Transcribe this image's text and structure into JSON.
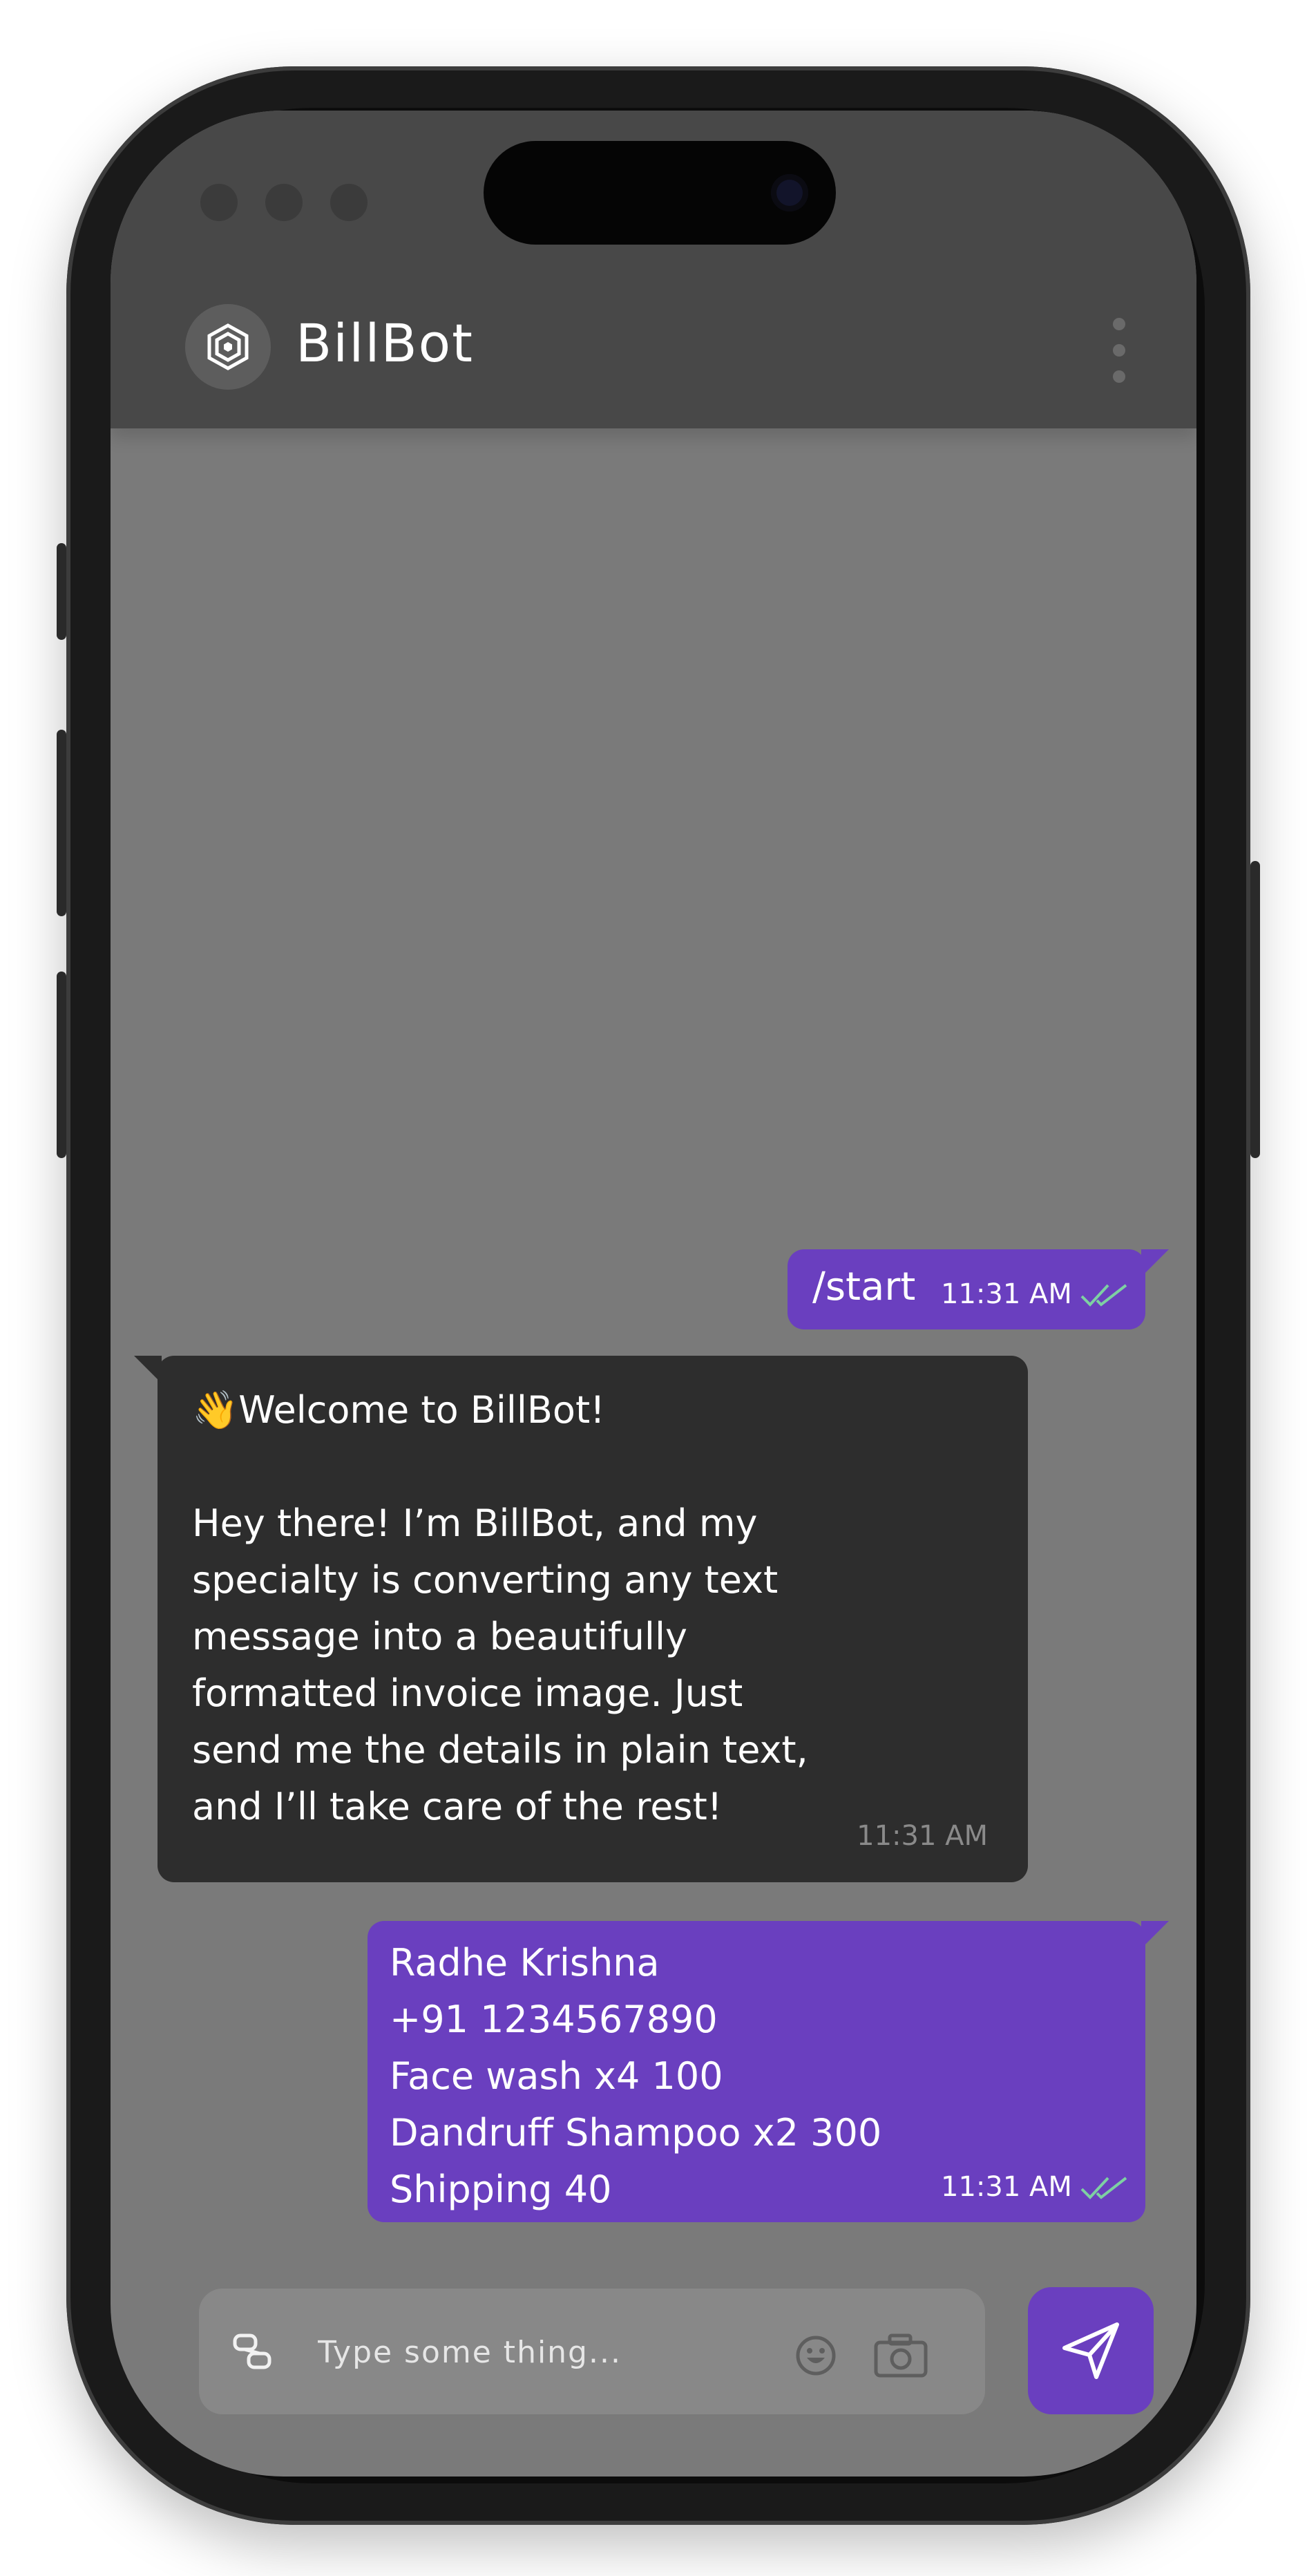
{
  "header": {
    "app_title": "BillBot",
    "logo_icon": "hexagon-logo-icon",
    "menu_icon": "kebab-menu-icon"
  },
  "messages": [
    {
      "sender": "user",
      "text": "/start",
      "time": "11:31 AM",
      "status": "read"
    },
    {
      "sender": "bot",
      "emoji": "👋",
      "text_lines": [
        "Welcome to BillBot!",
        "",
        "Hey there!  I’m BillBot, and my",
        "specialty is converting any text",
        "message into a beautifully",
        "formatted invoice image. Just",
        "send me the details in plain text,",
        "and I’ll take care of the rest!"
      ],
      "time": "11:31 AM"
    },
    {
      "sender": "user",
      "lines": [
        "Radhe Krishna",
        "+91 1234567890",
        "Face wash x4 100",
        "Dandruff Shampoo x2 300",
        "Shipping 40"
      ],
      "time": "11:31 AM",
      "status": "read"
    }
  ],
  "composer": {
    "placeholder": "Type some thing...",
    "value": "",
    "left_icon": "link-icon",
    "emoji_icon": "smiley-icon",
    "camera_icon": "camera-icon",
    "send_icon": "send-paper-plane-icon"
  },
  "colors": {
    "accent": "#6a3fbf",
    "header_bg": "#484848",
    "chat_bg": "#7a7a7a",
    "bot_bubble": "#2d2d2d",
    "read_ticks": "#7ed0a3"
  }
}
